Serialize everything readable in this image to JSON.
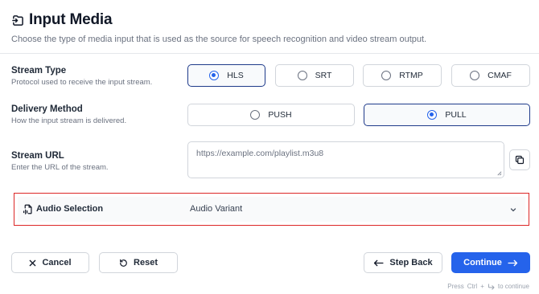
{
  "header": {
    "title": "Input Media",
    "subtitle": "Choose the type of media input that is used as the source for speech recognition and video stream output.",
    "icon": "media-input-icon"
  },
  "stream_type": {
    "label": "Stream Type",
    "description": "Protocol used to receive the input stream.",
    "options": [
      "HLS",
      "SRT",
      "RTMP",
      "CMAF"
    ],
    "selected": "HLS"
  },
  "delivery_method": {
    "label": "Delivery Method",
    "description": "How the input stream is delivered.",
    "options": [
      "PUSH",
      "PULL"
    ],
    "selected": "PULL"
  },
  "stream_url": {
    "label": "Stream URL",
    "description": "Enter the URL of the stream.",
    "placeholder": "https://example.com/playlist.m3u8",
    "value": ""
  },
  "audio_selection": {
    "label": "Audio Selection",
    "value": "Audio Variant"
  },
  "footer": {
    "cancel_label": "Cancel",
    "reset_label": "Reset",
    "step_back_label": "Step Back",
    "continue_label": "Continue",
    "hint_press": "Press",
    "hint_key": "Ctrl",
    "hint_plus": "+",
    "hint_action": "to continue"
  },
  "colors": {
    "accent": "#2563eb",
    "selected_border": "#1e3a8a",
    "highlight_border": "#dc2626"
  }
}
